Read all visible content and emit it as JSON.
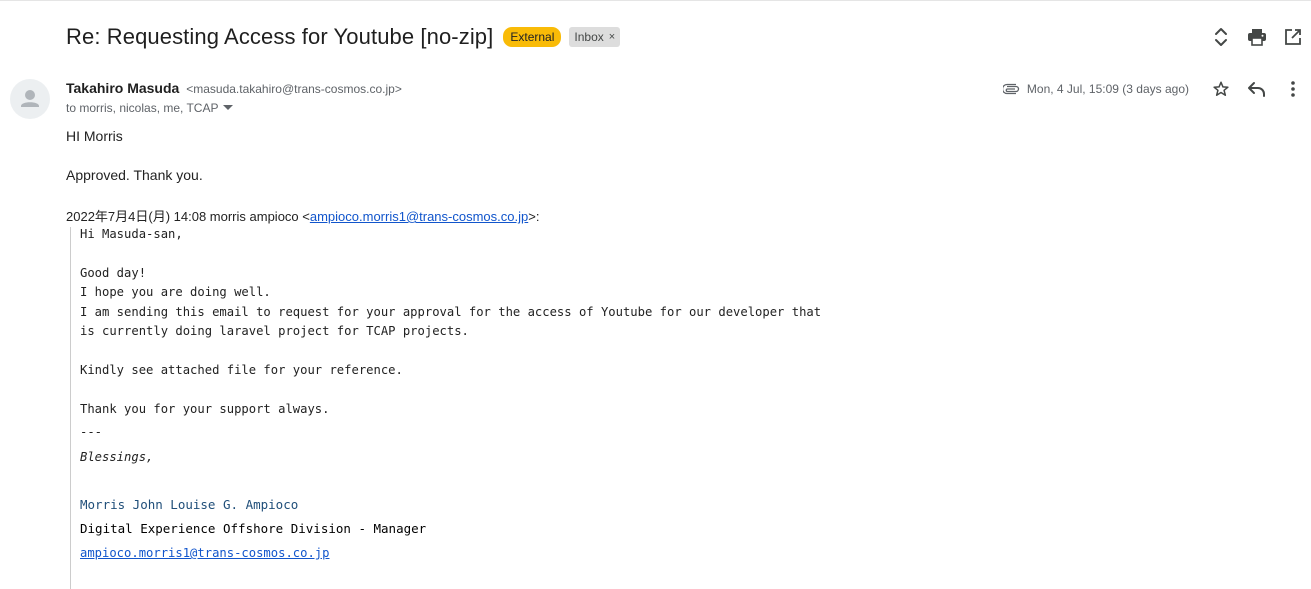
{
  "email": {
    "subject": "Re: Requesting Access for Youtube [no-zip]",
    "labels": {
      "external": "External",
      "inbox": "Inbox",
      "inbox_remove": "×"
    },
    "sender": {
      "name": "Takahiro Masuda",
      "email": "<masuda.takahiro@trans-cosmos.co.jp>"
    },
    "recipients": "to morris, nicolas, me, TCAP",
    "date": "Mon, 4 Jul, 15:09 (3 days ago)",
    "body": {
      "greeting": "HI Morris",
      "line1": "Approved. Thank you."
    },
    "quote_header": {
      "prefix": "2022年7月4日(月) 14:08 morris ampioco <",
      "email": "ampioco.morris1@trans-cosmos.co.jp",
      "suffix": ">:"
    },
    "quoted": {
      "l1": "Hi Masuda-san,",
      "l2": "Good day!",
      "l3": "I hope you are doing well.",
      "l4": "I am sending this email to request for your approval for the access of Youtube for our developer that",
      "l5": "is currently doing laravel project for TCAP projects.",
      "l6": "Kindly see attached file for your reference.",
      "l7": "Thank you for your support always.",
      "l8": "---",
      "l9": "Blessings,"
    },
    "signature": {
      "name": "Morris John Louise G. Ampioco",
      "title": "Digital Experience Offshore Division - Manager",
      "email": "ampioco.morris1@trans-cosmos.co.jp"
    }
  },
  "icons": {
    "expand": "expand-collapse-icon",
    "print": "print-icon",
    "open_new_window": "open-in-new-window-icon",
    "attachment": "paperclip-icon",
    "star": "star-icon",
    "reply": "reply-icon",
    "more": "more-vertical-icon",
    "avatar": "person-icon",
    "caret": "caret-down-icon"
  },
  "colors": {
    "external_label": "#f9bb07",
    "inbox_label": "#dddddd",
    "link": "#1155cc",
    "signature_name": "#1f4e79"
  }
}
